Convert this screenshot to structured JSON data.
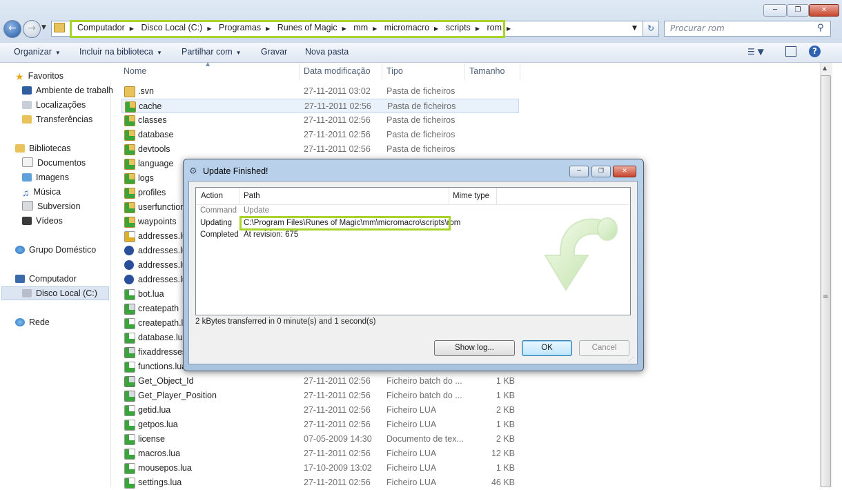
{
  "window": {
    "controls": [
      "minimize-icon",
      "maximize-icon",
      "close-icon"
    ]
  },
  "address": {
    "crumbs": [
      "Computador",
      "Disco Local (C:)",
      "Programas",
      "Runes of Magic",
      "mm",
      "micromacro",
      "scripts",
      "rom"
    ],
    "search_placeholder": "Procurar rom"
  },
  "commands": {
    "organize": "Organizar",
    "include": "Incluir na biblioteca",
    "share": "Partilhar com",
    "burn": "Gravar",
    "new_folder": "Nova pasta"
  },
  "nav": {
    "favorites": "Favoritos",
    "desktop": "Ambiente de trabalh",
    "places": "Localizações",
    "downloads": "Transferências",
    "libraries": "Bibliotecas",
    "documents": "Documentos",
    "images": "Imagens",
    "music": "Música",
    "subversion": "Subversion",
    "videos": "Vídeos",
    "homegroup": "Grupo Doméstico",
    "computer": "Computador",
    "local_disk": "Disco Local (C:)",
    "network": "Rede"
  },
  "columns": {
    "name": "Nome",
    "modified": "Data modificação",
    "type": "Tipo",
    "size": "Tamanho"
  },
  "files": [
    {
      "name": ".svn",
      "date": "27-11-2011 03:02",
      "type": "Pasta de ficheiros",
      "size": "",
      "icon": "folder"
    },
    {
      "name": "cache",
      "date": "27-11-2011 02:56",
      "type": "Pasta de ficheiros",
      "size": "",
      "icon": "svn-folder"
    },
    {
      "name": "classes",
      "date": "27-11-2011 02:56",
      "type": "Pasta de ficheiros",
      "size": "",
      "icon": "svn-folder"
    },
    {
      "name": "database",
      "date": "27-11-2011 02:56",
      "type": "Pasta de ficheiros",
      "size": "",
      "icon": "svn-folder"
    },
    {
      "name": "devtools",
      "date": "27-11-2011 02:56",
      "type": "Pasta de ficheiros",
      "size": "",
      "icon": "svn-folder"
    },
    {
      "name": "language",
      "date": "",
      "type": "",
      "size": "",
      "icon": "svn-folder"
    },
    {
      "name": "logs",
      "date": "",
      "type": "",
      "size": "",
      "icon": "svn-folder"
    },
    {
      "name": "profiles",
      "date": "",
      "type": "",
      "size": "",
      "icon": "svn-folder"
    },
    {
      "name": "userfunction",
      "date": "",
      "type": "",
      "size": "",
      "icon": "svn-folder"
    },
    {
      "name": "waypoints",
      "date": "",
      "type": "",
      "size": "",
      "icon": "svn-folder"
    },
    {
      "name": "addresses.lua",
      "date": "",
      "type": "",
      "size": "",
      "icon": "svn-warning"
    },
    {
      "name": "addresses.lua",
      "date": "",
      "type": "",
      "size": "",
      "icon": "svn-unknown"
    },
    {
      "name": "addresses.lua",
      "date": "",
      "type": "",
      "size": "",
      "icon": "svn-unknown"
    },
    {
      "name": "addresses.lua",
      "date": "",
      "type": "",
      "size": "",
      "icon": "svn-unknown"
    },
    {
      "name": "bot.lua",
      "date": "",
      "type": "",
      "size": "",
      "icon": "svn-file"
    },
    {
      "name": "createpath",
      "date": "",
      "type": "",
      "size": "",
      "icon": "svn-batch"
    },
    {
      "name": "createpath.lua",
      "date": "",
      "type": "",
      "size": "",
      "icon": "svn-file"
    },
    {
      "name": "database.lua",
      "date": "",
      "type": "",
      "size": "",
      "icon": "svn-file"
    },
    {
      "name": "fixaddresses",
      "date": "",
      "type": "",
      "size": "",
      "icon": "svn-batch"
    },
    {
      "name": "functions.lua",
      "date": "",
      "type": "",
      "size": "",
      "icon": "svn-file"
    },
    {
      "name": "Get_Object_Id",
      "date": "27-11-2011 02:56",
      "type": "Ficheiro batch do ...",
      "size": "1 KB",
      "icon": "svn-batch"
    },
    {
      "name": "Get_Player_Position",
      "date": "27-11-2011 02:56",
      "type": "Ficheiro batch do ...",
      "size": "1 KB",
      "icon": "svn-batch"
    },
    {
      "name": "getid.lua",
      "date": "27-11-2011 02:56",
      "type": "Ficheiro LUA",
      "size": "2 KB",
      "icon": "svn-file"
    },
    {
      "name": "getpos.lua",
      "date": "27-11-2011 02:56",
      "type": "Ficheiro LUA",
      "size": "1 KB",
      "icon": "svn-file"
    },
    {
      "name": "license",
      "date": "07-05-2009 14:30",
      "type": "Documento de tex...",
      "size": "2 KB",
      "icon": "svn-file"
    },
    {
      "name": "macros.lua",
      "date": "27-11-2011 02:56",
      "type": "Ficheiro LUA",
      "size": "12 KB",
      "icon": "svn-file"
    },
    {
      "name": "mousepos.lua",
      "date": "17-10-2009 13:02",
      "type": "Ficheiro LUA",
      "size": "1 KB",
      "icon": "svn-file"
    },
    {
      "name": "settings.lua",
      "date": "27-11-2011 02:56",
      "type": "Ficheiro LUA",
      "size": "46 KB",
      "icon": "svn-file"
    }
  ],
  "dialog": {
    "title": "Update Finished!",
    "columns": {
      "action": "Action",
      "path": "Path",
      "mime": "Mime type"
    },
    "rows": [
      {
        "action": "Command",
        "path": "Update",
        "muted": true
      },
      {
        "action": "Updating",
        "path": "C:\\Program Files\\Runes of Magic\\mm\\micromacro\\scripts\\rom",
        "muted": false
      },
      {
        "action": "Completed",
        "path": "At revision: 675",
        "muted": false
      }
    ],
    "status": "2 kBytes transferred in 0 minute(s) and 1 second(s)",
    "buttons": {
      "show_log": "Show log...",
      "ok": "OK",
      "cancel": "Cancel"
    }
  },
  "colors": {
    "highlight": "#a8d32a",
    "svn_green": "#3aa53a",
    "folder": "#e8c25b"
  }
}
